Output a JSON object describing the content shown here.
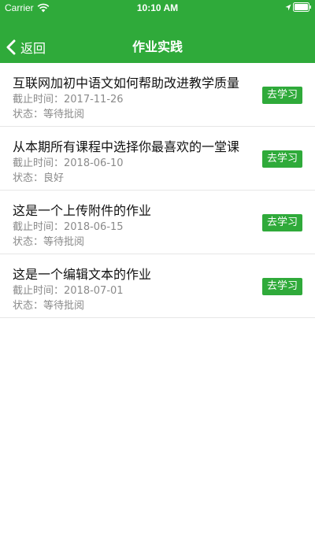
{
  "status_bar": {
    "carrier": "Carrier",
    "time": "10:10 AM"
  },
  "nav": {
    "back_label": "返回",
    "title": "作业实践"
  },
  "colors": {
    "brand_green": "#2faa3a",
    "secondary_text": "#8a8a8a"
  },
  "items": [
    {
      "title": "互联网加初中语文如何帮助改进教学质量",
      "deadline": "截止时间：2017-11-26",
      "status": "状态：等待批阅",
      "button": "去学习"
    },
    {
      "title": "从本期所有课程中选择你最喜欢的一堂课",
      "deadline": "截止时间：2018-06-10",
      "status": "状态：良好",
      "button": "去学习"
    },
    {
      "title": "这是一个上传附件的作业",
      "deadline": "截止时间：2018-06-15",
      "status": "状态：等待批阅",
      "button": "去学习"
    },
    {
      "title": "这是一个编辑文本的作业",
      "deadline": "截止时间：2018-07-01",
      "status": "状态：等待批阅",
      "button": "去学习"
    }
  ]
}
